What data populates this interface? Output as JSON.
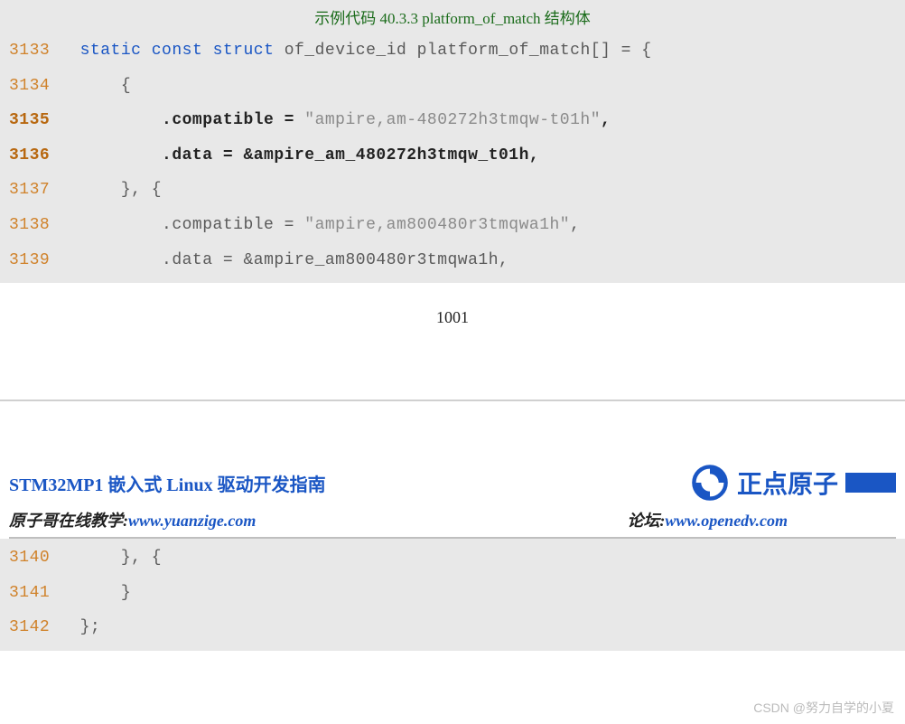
{
  "code_title": "示例代码 40.3.3 platform_of_match 结构体",
  "lines_top": [
    {
      "num": "3133",
      "bold": false,
      "segments": [
        {
          "pad": "  "
        },
        {
          "cls": "kw",
          "t": "static"
        },
        {
          "t": " "
        },
        {
          "cls": "kw",
          "t": "const"
        },
        {
          "t": " "
        },
        {
          "cls": "kw",
          "t": "struct"
        },
        {
          "t": " "
        },
        {
          "cls": "ident",
          "t": "of_device_id platform_of_match"
        },
        {
          "cls": "punct",
          "t": "[]"
        },
        {
          "t": " "
        },
        {
          "cls": "punct",
          "t": "="
        },
        {
          "t": " "
        },
        {
          "cls": "punct",
          "t": "{"
        }
      ]
    },
    {
      "num": "3134",
      "bold": false,
      "segments": [
        {
          "pad": "      "
        },
        {
          "cls": "punct",
          "t": "{"
        }
      ]
    },
    {
      "num": "3135",
      "bold": true,
      "segments": [
        {
          "pad": "          "
        },
        {
          "cls": "bold",
          "t": ".compatible = "
        },
        {
          "cls": "str",
          "t": "\"ampire,am-480272h3tmqw-t01h\""
        },
        {
          "cls": "bold",
          "t": ","
        }
      ]
    },
    {
      "num": "3136",
      "bold": true,
      "segments": [
        {
          "pad": "          "
        },
        {
          "cls": "bold",
          "t": ".data = &ampire_am_480272h3tmqw_t01h,"
        }
      ]
    },
    {
      "num": "3137",
      "bold": false,
      "segments": [
        {
          "pad": "      "
        },
        {
          "cls": "punct",
          "t": "}, {"
        }
      ]
    },
    {
      "num": "3138",
      "bold": false,
      "segments": [
        {
          "pad": "          "
        },
        {
          "cls": "ident",
          "t": ".compatible "
        },
        {
          "cls": "punct",
          "t": "= "
        },
        {
          "cls": "str",
          "t": "\"ampire,am800480r3tmqwa1h\""
        },
        {
          "cls": "punct",
          "t": ","
        }
      ]
    },
    {
      "num": "3139",
      "bold": false,
      "segments": [
        {
          "pad": "          "
        },
        {
          "cls": "ident",
          "t": ".data "
        },
        {
          "cls": "punct",
          "t": "= "
        },
        {
          "cls": "punct",
          "t": "&"
        },
        {
          "cls": "ident",
          "t": "ampire_am800480r3tmqwa1h"
        },
        {
          "cls": "punct",
          "t": ","
        }
      ]
    }
  ],
  "page_number": "1001",
  "doc_title": "STM32MP1 嵌入式 Linux 驱动开发指南",
  "brand_name": "正点原子",
  "teach_label": "原子哥在线教学:",
  "teach_url": "www.yuanzige.com",
  "forum_label": "论坛:",
  "forum_url": "www.openedv.com",
  "lines_bottom": [
    {
      "num": "3140",
      "bold": false,
      "segments": [
        {
          "pad": "      "
        },
        {
          "cls": "punct",
          "t": "}, {"
        }
      ]
    },
    {
      "num": "3141",
      "bold": false,
      "segments": [
        {
          "pad": "      "
        },
        {
          "cls": "punct",
          "t": "}"
        }
      ]
    },
    {
      "num": "3142",
      "bold": false,
      "segments": [
        {
          "pad": "  "
        },
        {
          "cls": "punct",
          "t": "};"
        }
      ]
    }
  ],
  "watermark": "CSDN @努力自学的小夏"
}
